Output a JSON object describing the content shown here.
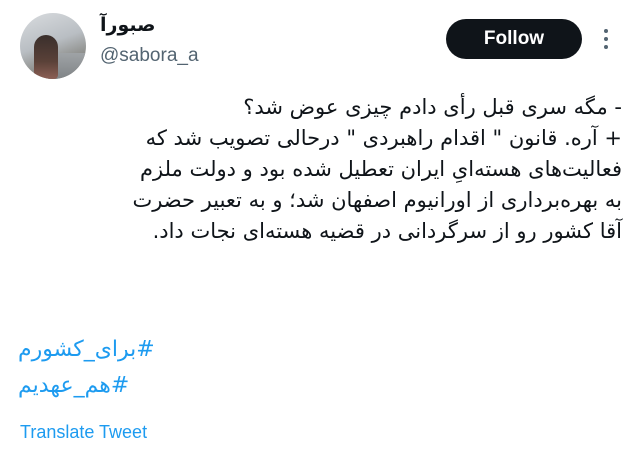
{
  "user": {
    "display_name": "صبورآ",
    "handle": "@sabora_a"
  },
  "actions": {
    "follow_label": "Follow",
    "more_icon": "more-vertical-icon"
  },
  "tweet": {
    "lines": [
      "- مگه سری قبل رأی دادم چیزی عوض شد؟",
      "+ آره. قانون \" اقدام راهبردی \" درحالی  تصویب شد که",
      "فعالیت‌های هسته‌ایِ ایران تعطیل شده بود و دولت ملزم",
      "به بهره‌برداری از اورانیوم اصفهان شد؛ و به تعبیر حضرت",
      "آقا کشور رو از سرگردانی در قضیه هسته‌ای نجات داد."
    ],
    "hashtags": [
      "#برای_کشورم",
      "#هم_عهدیم"
    ],
    "translate_label": "Translate Tweet"
  },
  "colors": {
    "link": "#1d9bf0",
    "text": "#0f1419",
    "secondary": "#536471",
    "button_bg": "#0f1419"
  }
}
